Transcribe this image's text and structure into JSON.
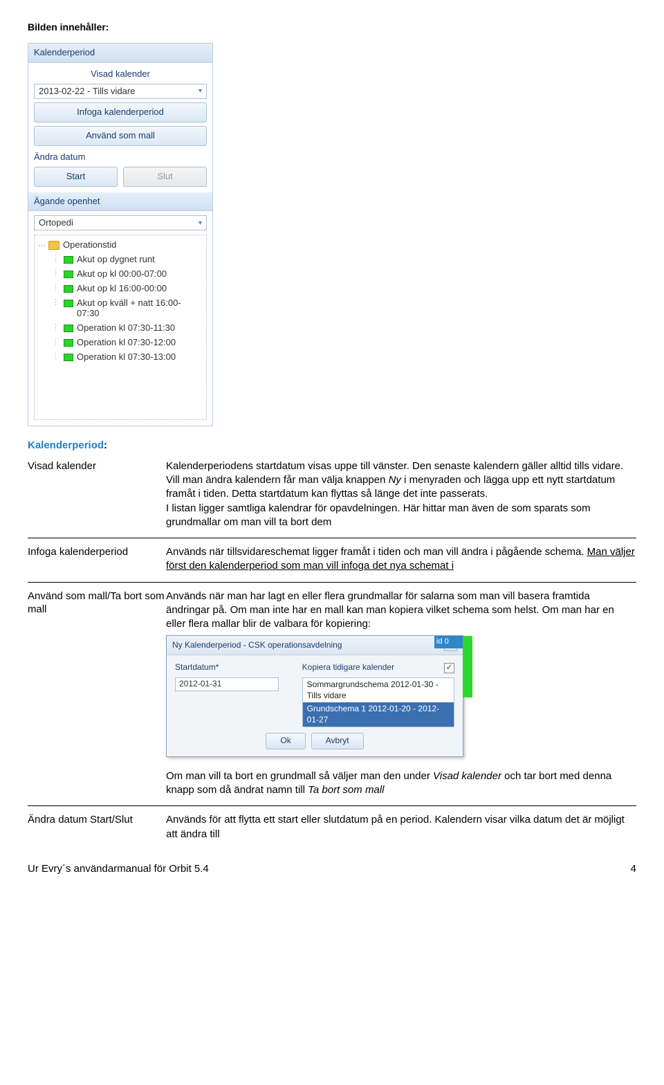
{
  "heading": "Bilden innehåller:",
  "panel": {
    "kalenderperiod_hdr": "Kalenderperiod",
    "visad_label": "Visad kalender",
    "visad_value": "2013-02-22 - Tills vidare",
    "btn_infoga": "Infoga kalenderperiod",
    "btn_mall": "Använd som mall",
    "andra_label": "Ändra datum",
    "btn_start": "Start",
    "btn_slut": "Slut",
    "agande_hdr": "Ägande openhet",
    "agande_value": "Ortopedi",
    "tree_root": "Operationstid",
    "tree_items": [
      "Akut op dygnet runt",
      "Akut op kl 00:00-07:00",
      "Akut op kl 16:00-00:00",
      "Akut op kväll + natt 16:00-07:30",
      "Operation kl 07:30-11:30",
      "Operation kl 07:30-12:00",
      "Operation kl 07:30-13:00"
    ]
  },
  "def_title": "Kalenderperiod",
  "defs": [
    {
      "term": "Visad kalender",
      "desc_parts": [
        {
          "t": "Kalenderperiodens startdatum visas uppe till vänster. Den senaste kalendern gäller alltid tills vidare. Vill man ändra kalendern får man välja knappen "
        },
        {
          "t": "Ny",
          "style": "italic"
        },
        {
          "t": " i menyraden och lägga upp ett nytt startdatum framåt i tiden. Detta startdatum kan flyttas så länge det inte passerats.\nI listan ligger samtliga kalendrar för opavdelningen. Här hittar man även de som sparats som grundmallar om man vill ta bort dem"
        }
      ]
    },
    {
      "term": "Infoga kalenderperiod",
      "desc_parts": [
        {
          "t": "Används när tillsvidareschemat ligger framåt i tiden och man vill ändra i pågående schema. "
        },
        {
          "t": "Man väljer först den kalenderperiod som man vill infoga det nya schemat i",
          "style": "underline"
        }
      ]
    },
    {
      "term": "Använd som mall/Ta bort som mall",
      "desc_parts": [
        {
          "t": "Används när man har lagt en eller flera grundmallar för salarna som man vill basera framtida ändringar på. Om man inte har en mall kan man kopiera vilket schema som helst. Om man har en eller flera mallar blir de valbara för kopiering:"
        }
      ],
      "show_dialog": true
    },
    {
      "term": "",
      "desc_parts": [
        {
          "t": "Om man vill ta bort en grundmall så väljer man den under "
        },
        {
          "t": "Visad kalender",
          "style": "italic"
        },
        {
          "t": " och tar bort med denna knapp som då ändrat namn till "
        },
        {
          "t": "Ta bort som mall",
          "style": "italic"
        }
      ]
    },
    {
      "term": "Ändra datum Start/Slut",
      "desc_parts": [
        {
          "t": "Används för att flytta ett start eller slutdatum på en period. Kalendern visar vilka datum det är möjligt att ändra till"
        }
      ]
    }
  ],
  "dialog": {
    "title": "Ny Kalenderperiod - CSK operationsavdelning",
    "start_label": "Startdatum*",
    "start_value": "2012-01-31",
    "copy_label": "Kopiera tidigare kalender",
    "check": "✓",
    "list_item1": "Sommargrundschema 2012-01-30 - Tills vidare",
    "list_item2": "Grundschema 1 2012-01-20 - 2012-01-27",
    "ok": "Ok",
    "cancel": "Avbryt",
    "side_id": "id    0"
  },
  "footer_text": "Ur Evry´s användarmanual för Orbit 5.4",
  "footer_page": "4"
}
